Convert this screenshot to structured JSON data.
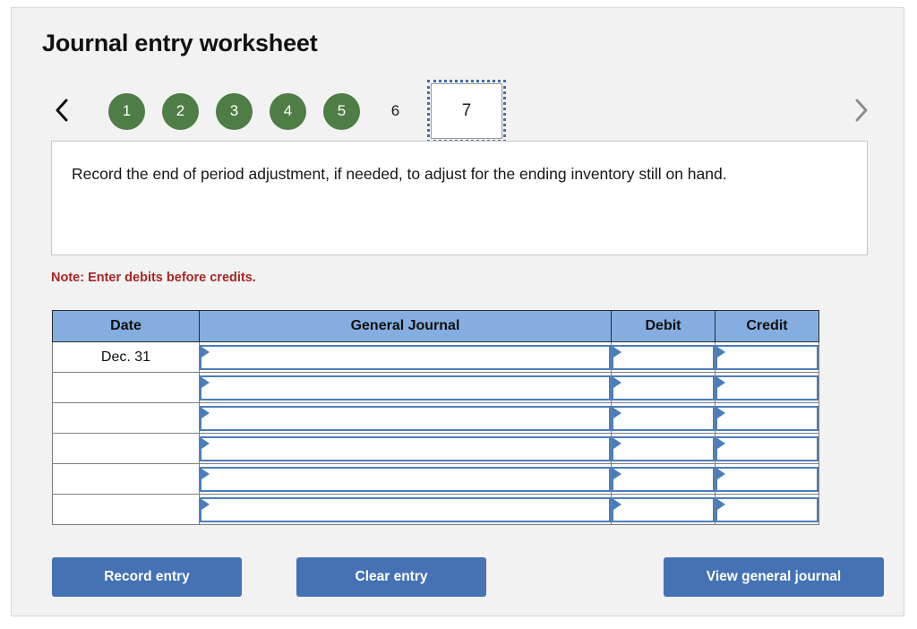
{
  "worksheet": {
    "title": "Journal entry worksheet",
    "prompt": "Record the end of period adjustment, if needed, to adjust for the ending inventory still on hand.",
    "note": "Note: Enter debits before credits."
  },
  "nav": {
    "prev_icon": "chevron-left-icon",
    "next_icon": "chevron-right-icon",
    "steps": [
      {
        "label": "1",
        "state": "done"
      },
      {
        "label": "2",
        "state": "done"
      },
      {
        "label": "3",
        "state": "done"
      },
      {
        "label": "4",
        "state": "done"
      },
      {
        "label": "5",
        "state": "done"
      },
      {
        "label": "6",
        "state": "plain"
      },
      {
        "label": "7",
        "state": "current"
      }
    ]
  },
  "table": {
    "columns": [
      "Date",
      "General Journal",
      "Debit",
      "Credit"
    ],
    "rows": [
      {
        "date": "Dec. 31",
        "general_journal": "",
        "debit": "",
        "credit": ""
      },
      {
        "date": "",
        "general_journal": "",
        "debit": "",
        "credit": ""
      },
      {
        "date": "",
        "general_journal": "",
        "debit": "",
        "credit": ""
      },
      {
        "date": "",
        "general_journal": "",
        "debit": "",
        "credit": ""
      },
      {
        "date": "",
        "general_journal": "",
        "debit": "",
        "credit": ""
      },
      {
        "date": "",
        "general_journal": "",
        "debit": "",
        "credit": ""
      }
    ]
  },
  "buttons": {
    "record": "Record entry",
    "clear": "Clear entry",
    "view": "View general journal"
  },
  "colors": {
    "panel_bg": "#f2f2f2",
    "step_done": "#4f7d46",
    "focus_ring": "#3a6fb5",
    "note_red": "#a62725",
    "header_blue": "#85aee0",
    "field_border": "#4a7ebb",
    "button_blue": "#4472b4"
  }
}
